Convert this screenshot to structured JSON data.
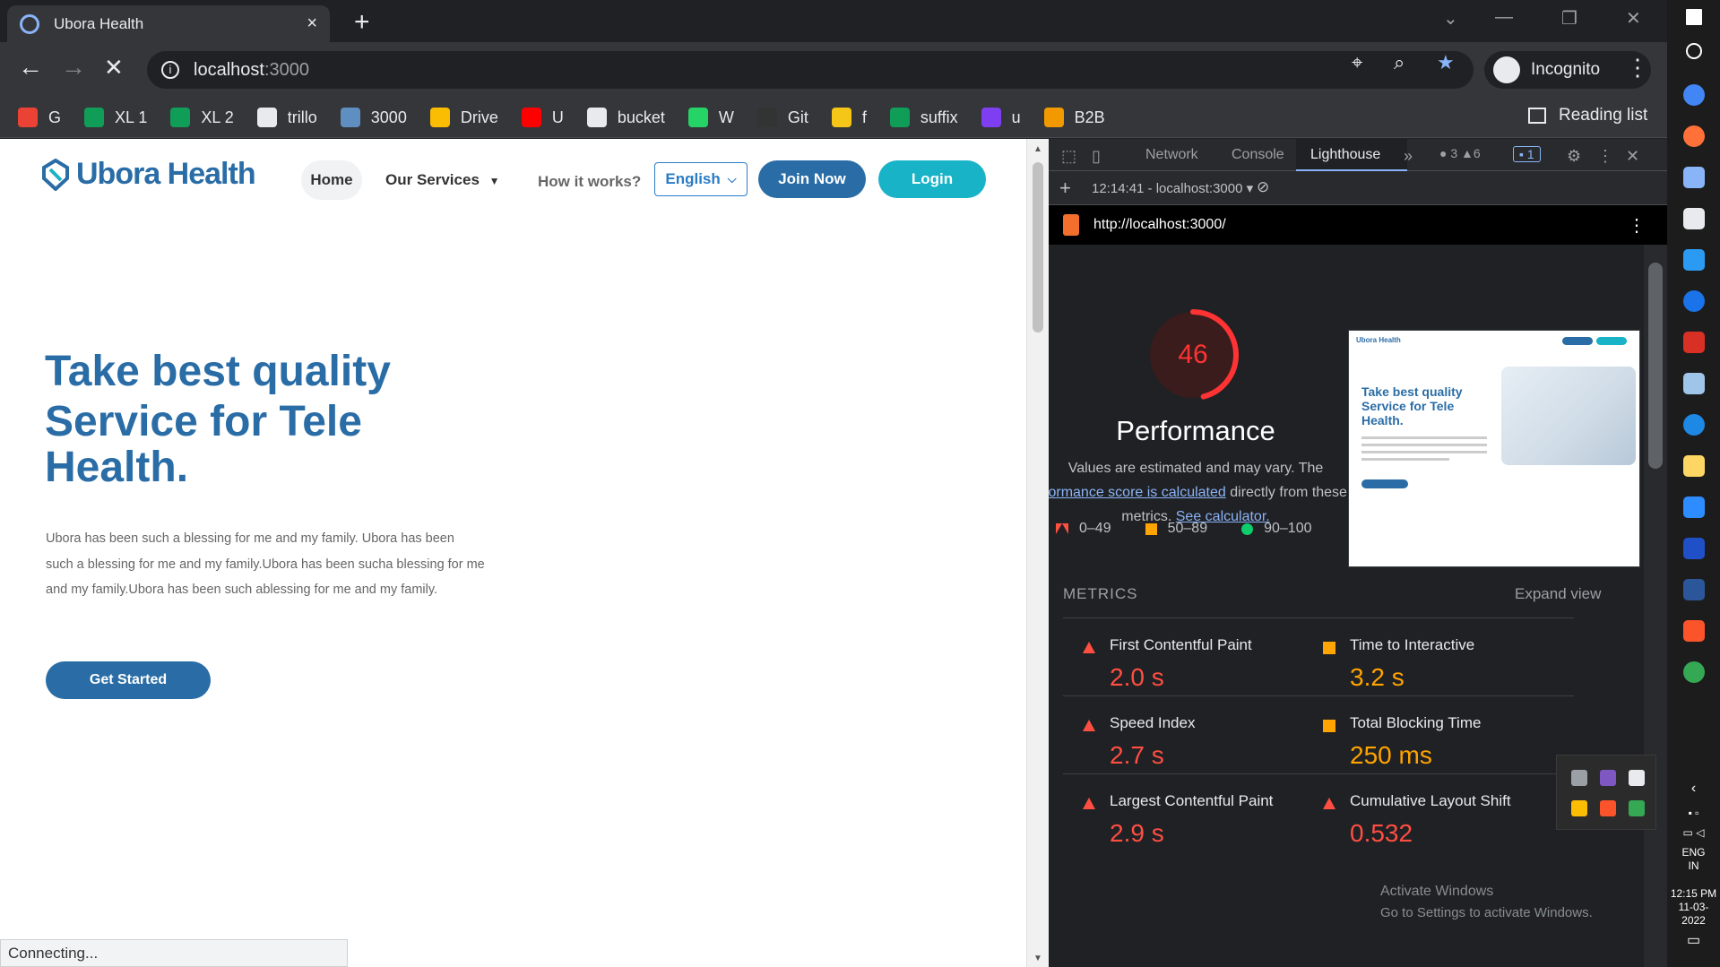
{
  "browser": {
    "tab_title": "Ubora Health",
    "tab_close": "×",
    "new_tab": "+",
    "url_host": "localhost",
    "url_port": ":3000",
    "profile": "Incognito",
    "bookmarks": [
      "G",
      "XL 1",
      "XL 2",
      "trillo",
      "3000",
      "Drive",
      "U",
      "bucket",
      "W",
      "Git",
      "f",
      "suffix",
      "u",
      "B2B"
    ],
    "bookmark_colors": [
      "#ea4335",
      "#0f9d58",
      "#0f9d58",
      "#e8eaed",
      "#5f8fc0",
      "#fbbc04",
      "#ff0000",
      "#e8eaed",
      "#25d366",
      "#333333",
      "#f5c518",
      "#0f9d58",
      "#7e3ff2",
      "#f29900"
    ],
    "reading_list": "Reading list",
    "status": "Connecting..."
  },
  "site": {
    "brand": "Ubora Health",
    "nav": {
      "home": "Home",
      "services": "Our Services",
      "how": "How it works?",
      "language": "English",
      "join": "Join Now",
      "login": "Login"
    },
    "hero": {
      "title_line1": "Take best quality",
      "title_line2": "Service for Tele",
      "title_line3": "Health.",
      "text": "Ubora has been such a blessing for me and my family. Ubora has been such a blessing for me and my family.Ubora has been sucha blessing for me and my family.Ubora has been such ablessing for me and my family.",
      "cta": "Get Started"
    },
    "colors": {
      "primary": "#2a6da6",
      "accent": "#19b3c8"
    }
  },
  "devtools": {
    "tabs": [
      "Network",
      "Console",
      "Lighthouse"
    ],
    "active_tab": "Lighthouse",
    "more": "»",
    "errors": "3",
    "warnings": "6",
    "messages": "1",
    "report_label": "12:14:41 - localhost:3000",
    "report_url": "http://localhost:3000/",
    "score": "46",
    "score_value": 0.46,
    "category": "Performance",
    "desc_line1": "Values are estimated and may vary. The",
    "desc_link1": "formance score is calculated",
    "desc_line2_rest": " directly from these",
    "desc_line3": "metrics. ",
    "desc_link2": "See calculator.",
    "legend": [
      "0–49",
      "50–89",
      "90–100"
    ],
    "metrics_heading": "METRICS",
    "expand": "Expand view",
    "metrics": [
      {
        "name": "First Contentful Paint",
        "value": "2.0 s",
        "rating": "red"
      },
      {
        "name": "Time to Interactive",
        "value": "3.2 s",
        "rating": "orange"
      },
      {
        "name": "Speed Index",
        "value": "2.7 s",
        "rating": "red"
      },
      {
        "name": "Total Blocking Time",
        "value": "250 ms",
        "rating": "orange"
      },
      {
        "name": "Largest Contentful Paint",
        "value": "2.9 s",
        "rating": "red"
      },
      {
        "name": "Cumulative Layout Shift",
        "value": "0.532",
        "rating": "red"
      }
    ],
    "thumb": {
      "brand": "Ubora Health",
      "title": "Take best quality Service for Tele Health."
    }
  },
  "windows": {
    "watermark1": "Activate Windows",
    "watermark2": "Go to Settings to activate Windows.",
    "lang1": "ENG",
    "lang2": "IN",
    "time": "12:15 PM",
    "date": "11-03-2022"
  }
}
